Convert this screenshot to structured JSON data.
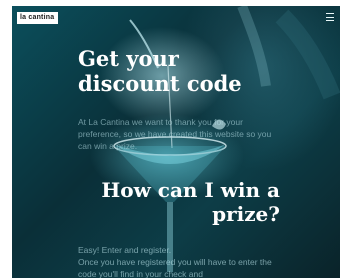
{
  "brand": {
    "name": "la cantina"
  },
  "menu": {
    "icon": "hamburger-icon"
  },
  "hero": {
    "title": "Get your discount code",
    "intro": "At La Cantina we want to thank you for your preference, so we have created this website so you can win a prize."
  },
  "section": {
    "title": "How can I win a prize?",
    "line1": "Easy! Enter and register.",
    "line2": "Once you have registered you will have to enter the code you'll find in your check and"
  },
  "colors": {
    "background": "#0a2f38",
    "accent": "#5fd0e0",
    "text": "#ffffff"
  }
}
